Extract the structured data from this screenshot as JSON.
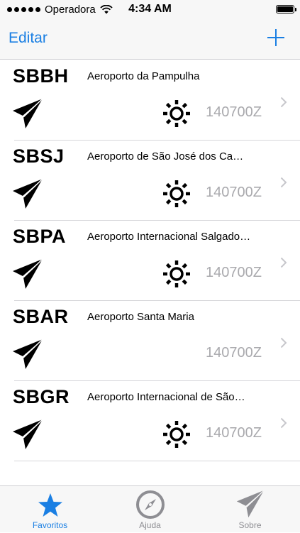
{
  "status_bar": {
    "carrier": "Operadora",
    "time": "4:34 AM"
  },
  "nav": {
    "edit_label": "Editar"
  },
  "airports": [
    {
      "code": "SBBH",
      "name": "Aeroporto da Pampulha",
      "time": "140700Z",
      "show_sun": true
    },
    {
      "code": "SBSJ",
      "name": "Aeroporto de São José dos Ca…",
      "time": "140700Z",
      "show_sun": true
    },
    {
      "code": "SBPA",
      "name": "Aeroporto Internacional Salgado…",
      "time": "140700Z",
      "show_sun": true
    },
    {
      "code": "SBAR",
      "name": "Aeroporto Santa Maria",
      "time": "140700Z",
      "show_sun": false
    },
    {
      "code": "SBGR",
      "name": "Aeroporto Internacional de São…",
      "time": "140700Z",
      "show_sun": true
    }
  ],
  "tabs": [
    {
      "label": "Favoritos",
      "icon": "star-icon",
      "active": true
    },
    {
      "label": "Ajuda",
      "icon": "compass-icon",
      "active": false
    },
    {
      "label": "Sobre",
      "icon": "paper-plane-icon",
      "active": false
    }
  ],
  "colors": {
    "accent": "#1a7fe3",
    "inactive": "#8e8e93",
    "muted_text": "#a9a9ad"
  }
}
